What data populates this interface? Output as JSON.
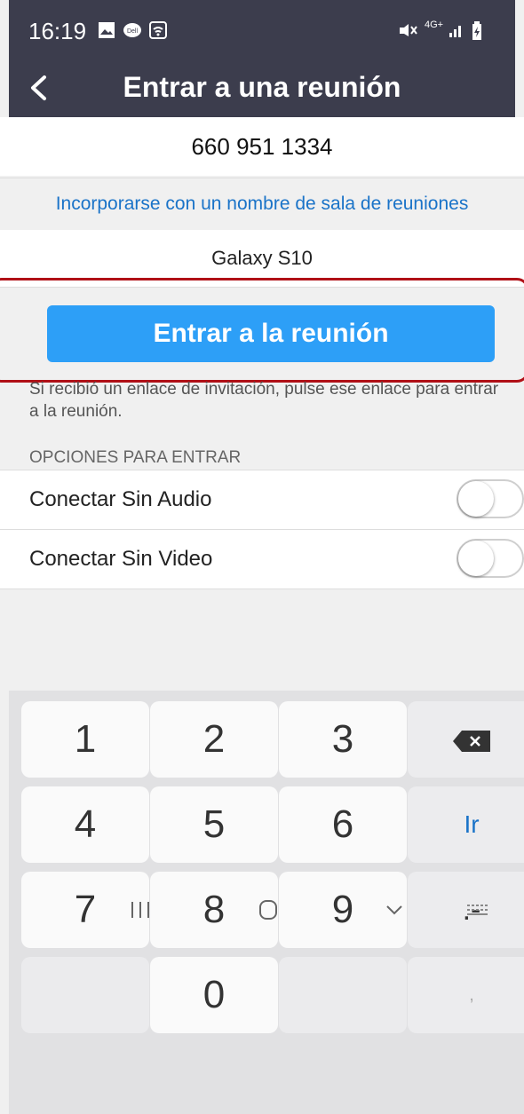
{
  "status_bar": {
    "time": "16:19",
    "left_icons": [
      "image-icon",
      "chat-icon",
      "wifi-call-icon"
    ],
    "right_icons": [
      "mute-icon",
      "4g-icon",
      "signal-icon",
      "battery-icon"
    ],
    "network_label": "4G+"
  },
  "header": {
    "back_icon": "chevron-left-icon",
    "title": "Entrar a una reunión"
  },
  "form": {
    "meeting_id": "660 951 1334",
    "room_name_link": "Incorporarse con un nombre de sala de reuniones",
    "display_name": "Galaxy S10",
    "join_button": "Entrar a la reunión",
    "hint": "Si recibió un enlace de invitación, pulse ese enlace para entrar a la reunión."
  },
  "options": {
    "header": "OPCIONES PARA ENTRAR",
    "items": [
      {
        "label": "Conectar Sin Audio",
        "enabled": false
      },
      {
        "label": "Conectar Sin Video",
        "enabled": false
      }
    ]
  },
  "keyboard": {
    "keys": [
      "1",
      "2",
      "3",
      "4",
      "5",
      "6",
      "7",
      "8",
      "9",
      "0"
    ],
    "go_label": "Ir",
    "dash_label": ".-",
    "comma_label": ",",
    "backspace_icon": "backspace-icon"
  },
  "nav_bar": {
    "icons": [
      "recent-apps-icon",
      "home-icon",
      "back-chevron-icon",
      "keyboard-switch-icon"
    ]
  },
  "colors": {
    "header_bg": "#3c3d4d",
    "accent_blue": "#2d9ff7",
    "link_blue": "#1a73c8",
    "highlight_red": "#b01016"
  }
}
